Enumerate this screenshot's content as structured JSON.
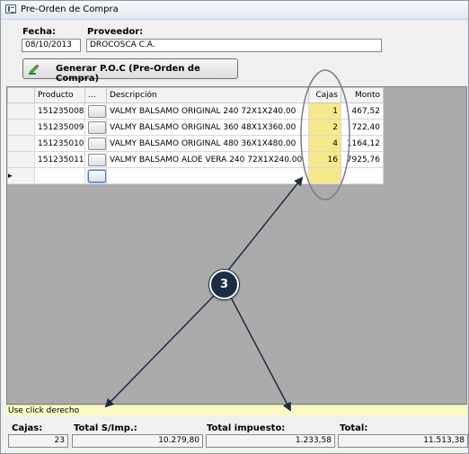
{
  "window": {
    "title": "Pre-Orden de Compra"
  },
  "form": {
    "fecha_label": "Fecha:",
    "fecha_value": "08/10/2013",
    "proveedor_label": "Proveedor:",
    "proveedor_value": "DROCOSCA C.A.",
    "generate_button_label": "Generar P.O.C (Pre-Orden de Compra)"
  },
  "grid": {
    "columns": {
      "producto": "Producto",
      "lookup": "...",
      "descripcion": "Descripción",
      "cajas": "Cajas",
      "monto": "Monto"
    },
    "rows": [
      {
        "producto": "151235008",
        "descripcion": "VALMY BALSAMO ORIGINAL 240 72X1X240.00",
        "cajas": "1",
        "monto": "467,52"
      },
      {
        "producto": "151235009",
        "descripcion": "VALMY BALSAMO ORIGINAL 360 48X1X360.00",
        "cajas": "2",
        "monto": "722,40"
      },
      {
        "producto": "151235010",
        "descripcion": "VALMY BALSAMO ORIGINAL 480 36X1X480.00",
        "cajas": "4",
        "monto": "1164,12"
      },
      {
        "producto": "151235011",
        "descripcion": "VALMY BALSAMO ALOE VERA 240 72X1X240.00",
        "cajas": "16",
        "monto": "7925,76"
      }
    ],
    "new_row_marker": "▸"
  },
  "status": {
    "text": "Use click derecho"
  },
  "totals": {
    "cajas_label": "Cajas:",
    "cajas_value": "23",
    "total_sin_imp_label": "Total S/Imp.:",
    "total_sin_imp_value": "10.279,80",
    "total_impuesto_label": "Total impuesto:",
    "total_impuesto_value": "1.233,58",
    "total_label": "Total:",
    "total_value": "11.513,38"
  },
  "annotation": {
    "badge_number": "3",
    "color": "#1c2c45",
    "highlight_color": "#f5e88a"
  }
}
